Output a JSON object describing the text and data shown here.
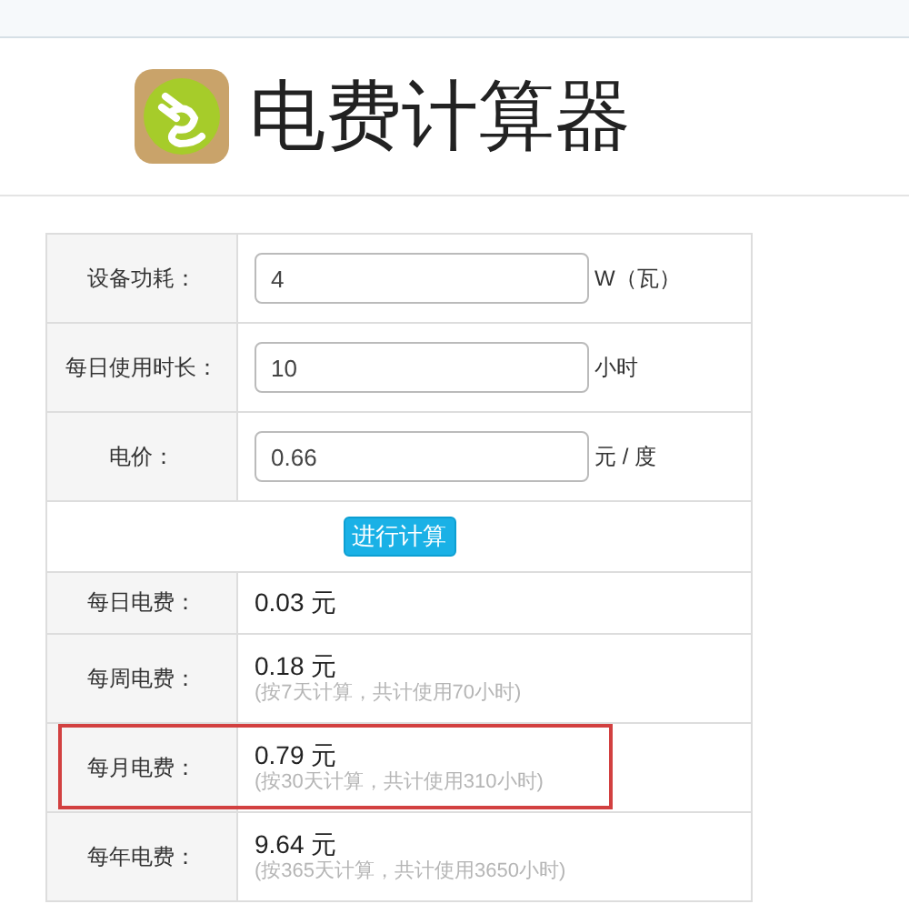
{
  "title": "电费计算器",
  "inputs": [
    {
      "label": "设备功耗：",
      "value": "4",
      "unit": "W（瓦）"
    },
    {
      "label": "每日使用时长：",
      "value": "10",
      "unit": "小时"
    },
    {
      "label": "电价：",
      "value": "0.66",
      "unit": "元 / 度"
    }
  ],
  "button": "进行计算",
  "results": [
    {
      "label": "每日电费：",
      "value": "0.03 元",
      "highlighted": false
    },
    {
      "label": "每周电费：",
      "value": "0.18 元",
      "note": "(按7天计算，共计使用70小时)",
      "highlighted": false
    },
    {
      "label": "每月电费：",
      "value": "0.79 元",
      "note": "(按30天计算，共计使用310小时)",
      "highlighted": true
    },
    {
      "label": "每年电费：",
      "value": "9.64 元",
      "note": "(按365天计算，共计使用3650小时)",
      "highlighted": false
    }
  ]
}
